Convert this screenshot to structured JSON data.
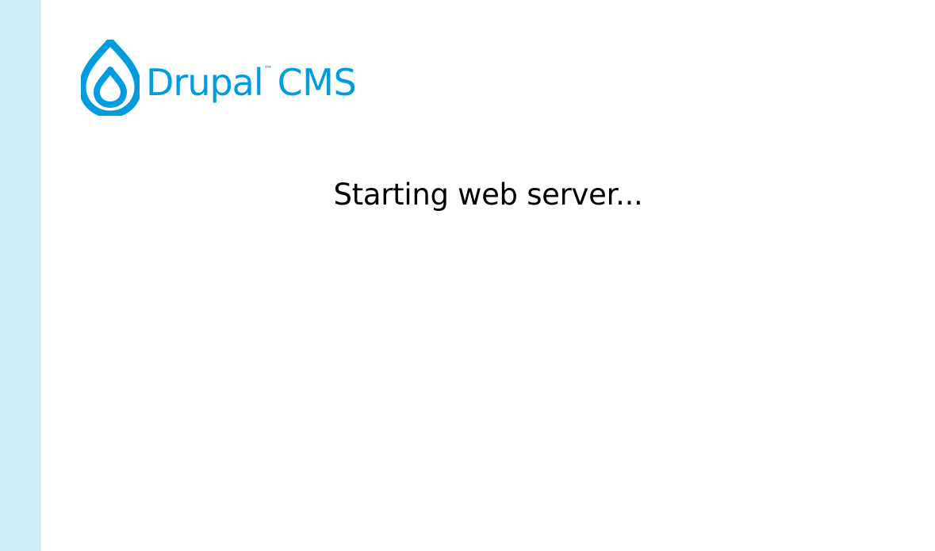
{
  "colors": {
    "side_strip": "#cdeef9",
    "brand": "#009cde",
    "text": "#000000",
    "background": "#ffffff"
  },
  "logo": {
    "icon": "drupal-drop-icon",
    "name": "Drupal",
    "trademark": "™",
    "product": "CMS"
  },
  "status": {
    "message": "Starting web server..."
  }
}
